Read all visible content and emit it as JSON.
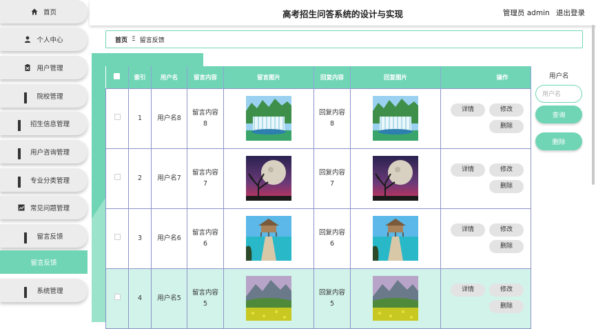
{
  "header": {
    "title": "高考招生问答系统的设计与实现",
    "user": "管理员 admin",
    "logout": "退出登录"
  },
  "sidebar": {
    "items": [
      {
        "label": "首页",
        "icon": "home-icon"
      },
      {
        "label": "个人中心",
        "icon": "user-icon"
      },
      {
        "label": "用户管理",
        "icon": "clipboard-icon"
      },
      {
        "label": "院校管理",
        "icon": "grid-icon"
      },
      {
        "label": "招生信息管理",
        "icon": "grid-icon"
      },
      {
        "label": "用户咨询管理",
        "icon": "grid-icon"
      },
      {
        "label": "专业分类管理",
        "icon": "grid-icon"
      },
      {
        "label": "常见问题管理",
        "icon": "chart-icon"
      },
      {
        "label": "留言反馈",
        "icon": "grid-icon"
      },
      {
        "label": "留言反馈",
        "icon": ""
      },
      {
        "label": "系统管理",
        "icon": "grid-icon"
      }
    ]
  },
  "breadcrumb": {
    "home": "首页",
    "separator": "Ξ",
    "current": "留言反馈"
  },
  "table": {
    "columns": [
      "索引",
      "用户名",
      "留言内容",
      "留言图片",
      "回复内容",
      "回复图片",
      "操作"
    ],
    "rows": [
      {
        "index": "1",
        "user": "用户名8",
        "msg_a": "留言内容",
        "msg_b": "8",
        "img": "waterfall-image",
        "reply_a": "回复内容",
        "reply_b": "8",
        "reply_img": "waterfall-image"
      },
      {
        "index": "2",
        "user": "用户名7",
        "msg_a": "留言内容",
        "msg_b": "7",
        "img": "moon-tree-image",
        "reply_a": "回复内容",
        "reply_b": "7",
        "reply_img": "moon-tree-image"
      },
      {
        "index": "3",
        "user": "用户名6",
        "msg_a": "留言内容",
        "msg_b": "6",
        "img": "beach-hut-image",
        "reply_a": "回复内容",
        "reply_b": "6",
        "reply_img": "beach-hut-image"
      },
      {
        "index": "4",
        "user": "用户名5",
        "msg_a": "留言内容",
        "msg_b": "5",
        "img": "mountain-flowers-image",
        "reply_a": "回复内容",
        "reply_b": "5",
        "reply_img": "mountain-flowers-image"
      }
    ],
    "actions": {
      "detail": "详情",
      "edit": "修改",
      "delete": "删除"
    }
  },
  "search": {
    "label": "用户名",
    "placeholder": "用户名",
    "query_button": "查询",
    "delete_button": "删除"
  },
  "colors": {
    "accent": "#6fd5b4",
    "highlight_row": "#d2f3e9",
    "menu_bg": "#ececec"
  }
}
